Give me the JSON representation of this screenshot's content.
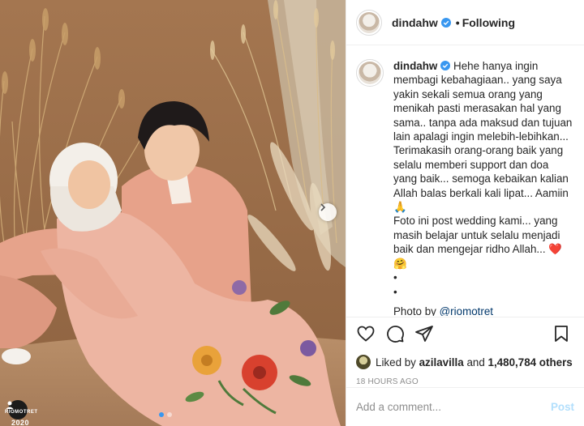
{
  "header": {
    "username": "dindahw",
    "separator": "•",
    "follow_label": "Following"
  },
  "caption": {
    "username": "dindahw",
    "text": "Hehe hanya ingin membagi kebahagiaan.. yang saya yakin sekali semua orang yang menikah pasti merasakan hal yang sama.. tanpa ada maksud dan tujuan lain apalagi ingin melebih-lebihkan... Terimakasih orang-orang baik yang selalu memberi support dan doa yang baik... semoga kebaikan kalian Allah balas berkali kali lipat... Aamiin 🙏\nFoto ini post wedding kami... yang masih belajar untuk selalu menjadi baik dan mengejar ridho Allah... ❤️ 🤗\n•\n•",
    "photo_by_prefix": "Photo by",
    "photo_by_mention": "@riomotret"
  },
  "likes": {
    "prefix": "Liked by",
    "user": "azilavilla",
    "connector": "and",
    "count": "1,480,784 others"
  },
  "timestamp": "18 HOURS AGO",
  "comment_box": {
    "placeholder": "Add a comment...",
    "post_label": "Post"
  },
  "photo": {
    "watermark_year": "2020",
    "watermark_name": "RIOMOTRET",
    "carousel_dots": 2,
    "active_dot": 1
  },
  "colors": {
    "verified_blue": "#3897f0",
    "link_blue": "#00376b",
    "post_disabled": "#b2dffc",
    "suit_pink": "#e9a78e",
    "dress_pink": "#edb8a5"
  },
  "icons": [
    "heart-icon",
    "comment-icon",
    "share-icon",
    "bookmark-icon",
    "verified-icon",
    "chevron-right-icon"
  ]
}
